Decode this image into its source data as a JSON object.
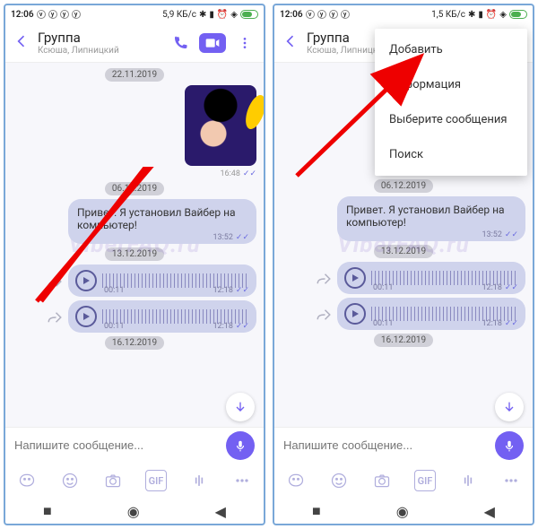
{
  "status": {
    "time": "12:06",
    "rate_a": "5,9 КБ/с",
    "rate_b": "1,5 КБ/с"
  },
  "header": {
    "title": "Группа",
    "subtitle": "Ксюша, Липницкий"
  },
  "dates": {
    "d1": "22.11.2019",
    "d2": "06.12.2019",
    "d3": "13.12.2019",
    "d4": "16.12.2019"
  },
  "sticker_time": "16:48",
  "msg1": {
    "text": "Привет. Я установил Вайбер на компьютер!",
    "time": "13:52"
  },
  "voice1": {
    "dur": "00:11",
    "time": "12:18"
  },
  "voice2": {
    "dur": "00:11",
    "time": "12:18"
  },
  "menu": {
    "add": "Добавить",
    "info": "Информация",
    "select": "Выберите сообщения",
    "search": "Поиск"
  },
  "input_placeholder": "Напишите сообщение...",
  "gif_label": "GIF",
  "watermark": "ViberFAQ.ru"
}
